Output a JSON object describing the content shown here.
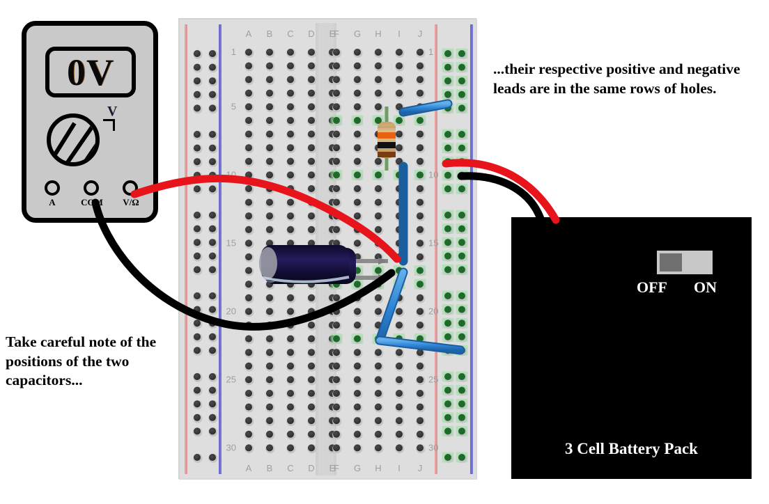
{
  "annotations": {
    "top_note": "...their respective positive and negative leads are in the same rows of holes.",
    "bottom_note": "Take careful note of the positions of the two capacitors..."
  },
  "multimeter": {
    "label": "multimeter",
    "display_reading": "0V",
    "dial_mode": "V",
    "jacks": [
      {
        "name": "A",
        "label": "A"
      },
      {
        "name": "COM",
        "label": "COM"
      },
      {
        "name": "V-Ohm",
        "label": "V/Ω"
      }
    ]
  },
  "battery_pack": {
    "title": "3 Cell Battery Pack",
    "switch": {
      "off_label": "OFF",
      "on_label": "ON",
      "position": "OFF"
    }
  },
  "breadboard": {
    "column_labels_left": [
      "A",
      "B",
      "C",
      "D",
      "E"
    ],
    "column_labels_right": [
      "F",
      "G",
      "H",
      "I",
      "J"
    ],
    "row_labels": [
      1,
      5,
      10,
      15,
      20,
      25,
      30
    ],
    "total_rows": 30,
    "rail_plus_color": "#e06666",
    "rail_minus_color": "#3333cc"
  },
  "components": {
    "resistor": {
      "name": "resistor",
      "bands": [
        "orange",
        "black",
        "brown"
      ],
      "body_color": "#d9b47e",
      "lead_color": "#6a9b5e"
    },
    "capacitors": [
      {
        "name": "capacitor-1",
        "body_color": "#15103c"
      },
      {
        "name": "capacitor-2",
        "body_color": "#15103c"
      }
    ],
    "jumper_wires": [
      {
        "name": "jumper-top",
        "color": "#2f86d8"
      },
      {
        "name": "jumper-vertical",
        "color": "#2f86d8"
      },
      {
        "name": "jumper-diagonal",
        "color": "#2f86d8"
      },
      {
        "name": "jumper-bottom",
        "color": "#2f86d8"
      }
    ],
    "probe_leads": [
      {
        "name": "red-probe-lead",
        "color": "#e8141c"
      },
      {
        "name": "black-probe-lead",
        "color": "#000000"
      }
    ],
    "battery_leads": [
      {
        "name": "battery-red-lead",
        "color": "#e8141c"
      },
      {
        "name": "battery-black-lead",
        "color": "#000000"
      }
    ]
  },
  "colors": {
    "board_body": "#d8d8d8",
    "hole": "#3a3a3a",
    "highlight_green": "#8fe39a",
    "wire_blue": "#2f86d8",
    "wire_red": "#e8141c",
    "meter_body": "#c9c9c9"
  }
}
